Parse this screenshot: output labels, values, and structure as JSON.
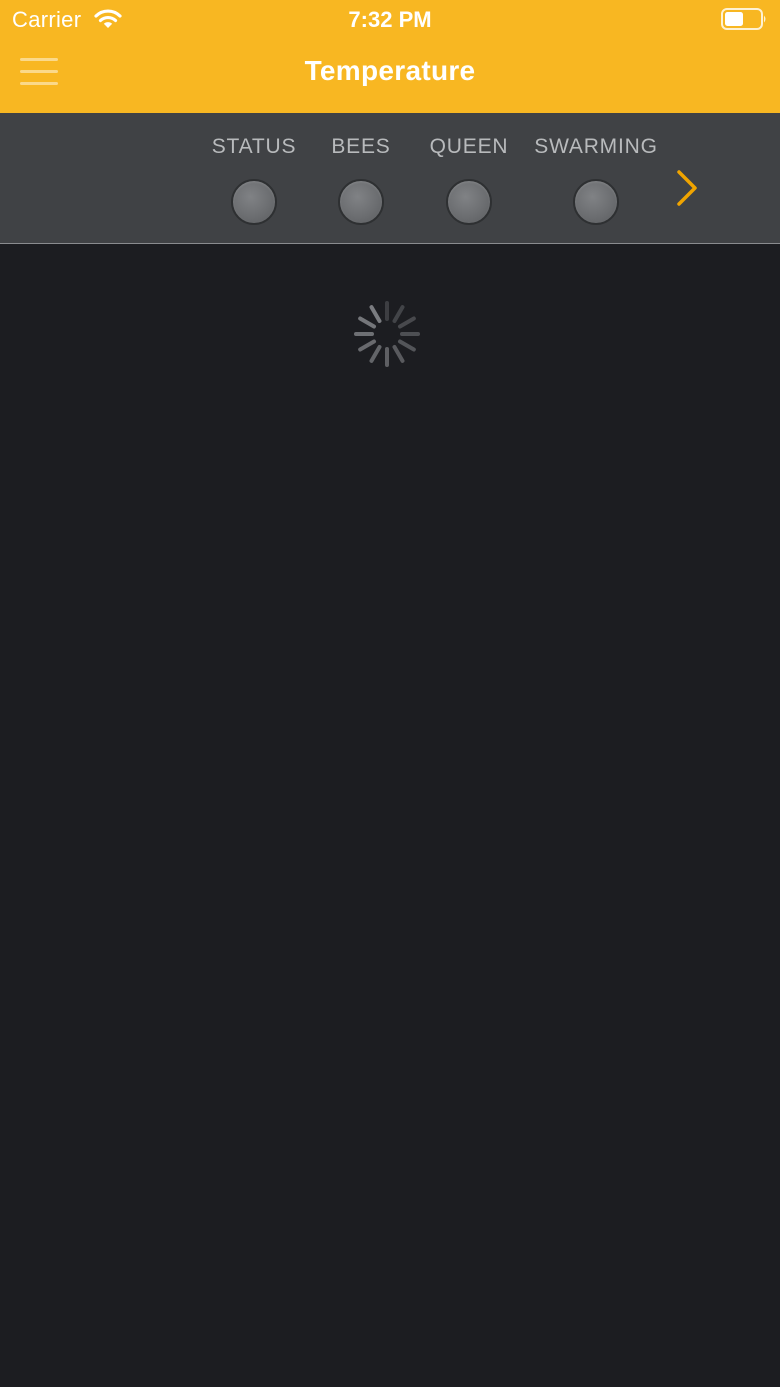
{
  "status_bar": {
    "carrier": "Carrier",
    "time": "7:32 PM",
    "wifi_icon": "wifi-icon",
    "battery_icon": "battery-icon"
  },
  "nav": {
    "menu_icon": "hamburger-menu-icon",
    "title": "Temperature"
  },
  "tabs": [
    {
      "label": "STATUS",
      "indicator": "grey-dot"
    },
    {
      "label": "BEES",
      "indicator": "grey-dot"
    },
    {
      "label": "QUEEN",
      "indicator": "grey-dot"
    },
    {
      "label": "SWARMING",
      "indicator": "grey-dot"
    }
  ],
  "tabs_next_icon": "chevron-right-icon",
  "content": {
    "loading_icon": "spinner-icon"
  },
  "colors": {
    "accent": "#f8b722",
    "tab_bar_bg": "#404245",
    "content_bg": "#1c1d21",
    "indicator": "#6c6e71",
    "chevron": "#f0a400"
  }
}
